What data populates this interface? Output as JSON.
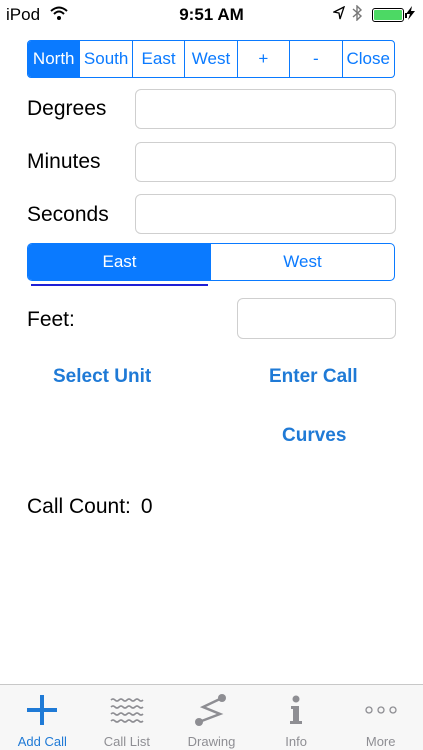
{
  "status_bar": {
    "carrier": "iPod",
    "time": "9:51 AM"
  },
  "direction_segments": {
    "items": [
      {
        "label": "North",
        "selected": true
      },
      {
        "label": "South",
        "selected": false
      },
      {
        "label": "East",
        "selected": false
      },
      {
        "label": "West",
        "selected": false
      },
      {
        "label": "+",
        "selected": false
      },
      {
        "label": "-",
        "selected": false
      },
      {
        "label": "Close",
        "selected": false
      }
    ]
  },
  "form": {
    "degrees_label": "Degrees",
    "degrees_value": "",
    "minutes_label": "Minutes",
    "minutes_value": "",
    "seconds_label": "Seconds",
    "seconds_value": "",
    "feet_label": "Feet:",
    "feet_value": ""
  },
  "east_west_toggle": {
    "items": [
      {
        "label": "East",
        "selected": true
      },
      {
        "label": "West",
        "selected": false
      }
    ]
  },
  "actions": {
    "select_unit": "Select Unit",
    "enter_call": "Enter Call",
    "curves": "Curves"
  },
  "call_count": {
    "label": "Call Count:",
    "value": "0"
  },
  "tab_bar": {
    "items": [
      {
        "label": "Add Call",
        "icon": "plus-icon",
        "active": true
      },
      {
        "label": "Call List",
        "icon": "wavy-lines-icon",
        "active": false
      },
      {
        "label": "Drawing",
        "icon": "drawing-icon",
        "active": false
      },
      {
        "label": "Info",
        "icon": "info-icon",
        "active": false
      },
      {
        "label": "More",
        "icon": "more-icon",
        "active": false
      }
    ]
  },
  "colors": {
    "accent": "#0a7aff",
    "link": "#1f7ad6",
    "tab_inactive": "#8e8e93",
    "battery": "#4cd964"
  }
}
